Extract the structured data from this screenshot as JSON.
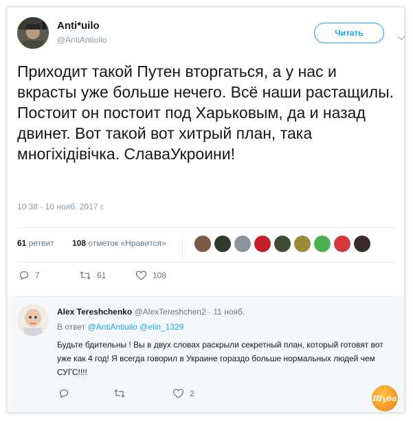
{
  "tweet": {
    "author_name": "Anti*uilo",
    "author_handle": "@AntiAntiuilo",
    "follow_label": "Читать",
    "text": "Приходит такой Путен вторгаться, а у нас и вкрасты уже больше нечего. Всё наши растащилы. Постоит он постоит под Харьковым, да и назад двинет. Вот такой вот хитрый план, така многіхідівічка. СлаваУкроини!",
    "timestamp": "10:38 - 10 нояб. 2017 г.",
    "retweets_count": "61",
    "retweets_label": "ретвит",
    "likes_count": "108",
    "likes_label": "отметок «Нравится»",
    "actions": {
      "reply_count": "7",
      "retweet_count": "61",
      "like_count": "108"
    }
  },
  "likers": [
    {
      "icon": "avatar-liker-1",
      "color": "#7a5a44"
    },
    {
      "icon": "avatar-liker-2",
      "color": "#2f3a2d"
    },
    {
      "icon": "avatar-liker-3",
      "color": "#8c939a"
    },
    {
      "icon": "avatar-liker-4",
      "color": "#c21f2a"
    },
    {
      "icon": "avatar-liker-5",
      "color": "#3f4b35"
    },
    {
      "icon": "avatar-liker-6",
      "color": "#9a8a3a"
    },
    {
      "icon": "avatar-liker-7",
      "color": "#4caf50"
    },
    {
      "icon": "avatar-liker-8",
      "color": "#d23b3b"
    },
    {
      "icon": "avatar-liker-9",
      "color": "#3a2a2a"
    }
  ],
  "reply": {
    "author_name": "Alex Tereshchenko",
    "author_handle": "@AlexTereshchen2",
    "date": "· 11 нояб.",
    "in_reply_prefix": "В ответ",
    "mention_1": "@AntiAntiuilo",
    "mention_2": "@elin_1329",
    "text": "Будьте бдительны ! Вы в двух словах раскрыли секретный план,  который готовят вот уже как 4 год! Я всегда говорил в Украине гораздо больше нормальных людей чем СУГС!!!!",
    "like_count": "2"
  },
  "watermark": {
    "text": "Шуба"
  },
  "colors": {
    "accent": "#1da1f2",
    "muted": "#8899a6",
    "text": "#14171a",
    "border": "#e1e8ed"
  }
}
